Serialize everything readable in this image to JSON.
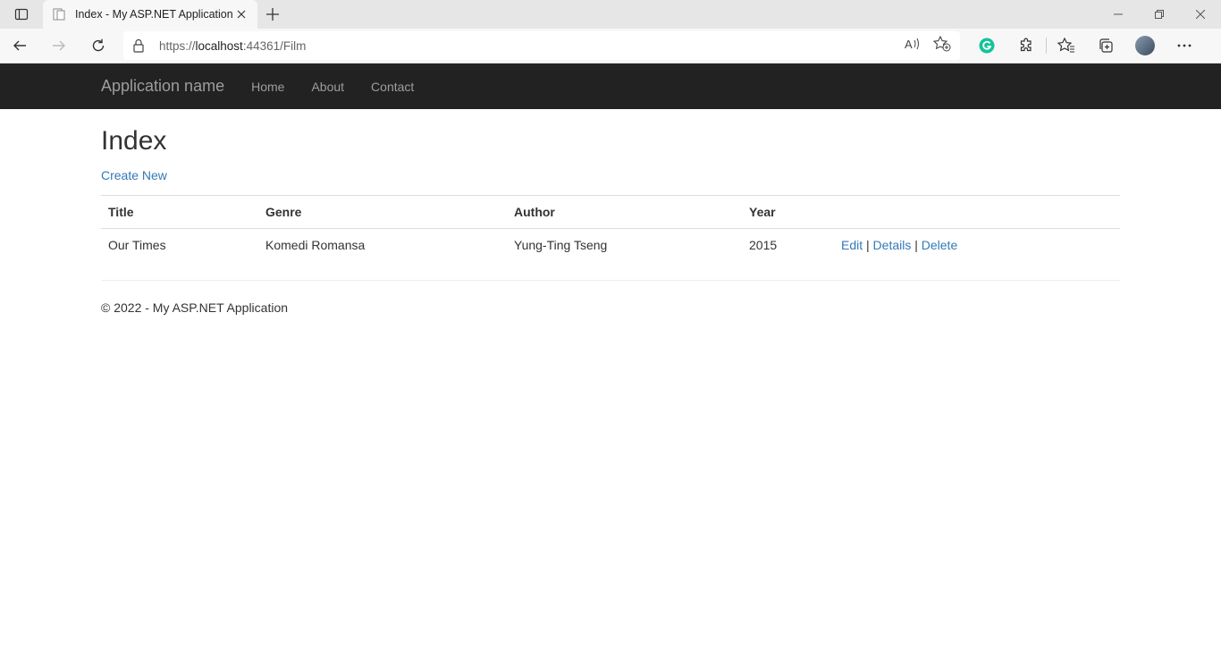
{
  "browser": {
    "tab_title": "Index - My ASP.NET Application",
    "url_scheme": "https://",
    "url_host": "localhost",
    "url_rest": ":44361/Film"
  },
  "site": {
    "brand": "Application name",
    "nav": [
      "Home",
      "About",
      "Contact"
    ]
  },
  "page": {
    "title": "Index",
    "create_link": "Create New",
    "table": {
      "headers": [
        "Title",
        "Genre",
        "Author",
        "Year"
      ],
      "rows": [
        {
          "title": "Our Times",
          "genre": "Komedi Romansa",
          "author": "Yung-Ting Tseng",
          "year": "2015",
          "actions": {
            "edit": "Edit",
            "details": "Details",
            "delete": "Delete",
            "separator": "|"
          }
        }
      ]
    },
    "footer": "© 2022 - My ASP.NET Application"
  },
  "colors": {
    "navbar": "#222222",
    "link": "#337ab7",
    "grammarly": "#15c39a"
  }
}
